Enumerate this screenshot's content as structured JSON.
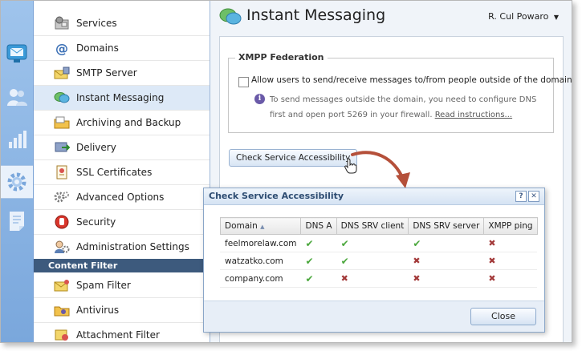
{
  "sidebar": {
    "items": [
      {
        "label": "Services",
        "icon": "services-icon"
      },
      {
        "label": "Domains",
        "icon": "at-sign-icon"
      },
      {
        "label": "SMTP Server",
        "icon": "smtp-server-icon"
      },
      {
        "label": "Instant Messaging",
        "icon": "chat-bubbles-icon"
      },
      {
        "label": "Archiving and Backup",
        "icon": "archive-folder-icon"
      },
      {
        "label": "Delivery",
        "icon": "delivery-icon"
      },
      {
        "label": "SSL Certificates",
        "icon": "certificate-icon"
      },
      {
        "label": "Advanced Options",
        "icon": "gears-icon"
      },
      {
        "label": "Security",
        "icon": "security-hand-icon"
      },
      {
        "label": "Administration Settings",
        "icon": "admin-settings-icon"
      }
    ],
    "section_header": "Content Filter",
    "filter_items": [
      {
        "label": "Spam Filter",
        "icon": "spam-filter-icon"
      },
      {
        "label": "Antivirus",
        "icon": "antivirus-icon"
      },
      {
        "label": "Attachment Filter",
        "icon": "attachment-filter-icon"
      }
    ],
    "selected": "Instant Messaging"
  },
  "header": {
    "title": "Instant Messaging",
    "user_menu": "R. Cul Powaro"
  },
  "xmpp": {
    "legend": "XMPP Federation",
    "checkbox_label": "Allow users to send/receive messages to/from people outside of the domain",
    "checked": false,
    "info_text": "To send messages outside the domain, you need to configure DNS first and open port 5269 in your firewall.",
    "info_link": "Read instructions..."
  },
  "check_button": "Check Service Accessibility",
  "dialog": {
    "title": "Check Service Accessibility",
    "help_label": "?",
    "close_x_label": "✕",
    "columns": [
      "Domain",
      "DNS A",
      "DNS SRV client",
      "DNS SRV server",
      "XMPP ping"
    ],
    "rows": [
      {
        "domain": "feelmorelaw.com",
        "dns_a": "✔",
        "dns_srv_client": "✔",
        "dns_srv_server": "✔",
        "xmpp_ping": "✖"
      },
      {
        "domain": "watzatko.com",
        "dns_a": "✔",
        "dns_srv_client": "✔",
        "dns_srv_server": "✖",
        "xmpp_ping": "✖"
      },
      {
        "domain": "company.com",
        "dns_a": "✔",
        "dns_srv_client": "✖",
        "dns_srv_server": "✖",
        "xmpp_ping": "✖"
      }
    ],
    "close_button": "Close"
  },
  "colors": {
    "accent": "#3d5a7d",
    "ok": "#4aa73c",
    "fail": "#a33a3a",
    "annotation_arrow": "#b5503a"
  }
}
